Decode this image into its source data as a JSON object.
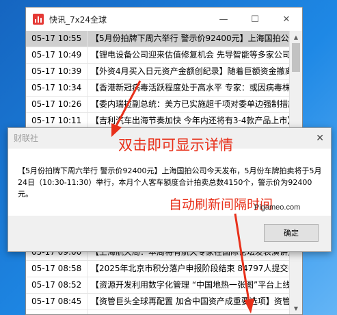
{
  "window": {
    "title": "快讯_7x24全球",
    "icon": "bar-chart-icon",
    "buttons": {
      "minimize": "—",
      "maximize": "☐",
      "close": "✕"
    }
  },
  "news": [
    {
      "time": "05-17 10:55",
      "text": "【5月份拍牌下周六举行 警示价92400元】上海国拍公司今天发布",
      "selected": true
    },
    {
      "time": "05-17 10:49",
      "text": "【锂电设备公司迎来估值修复机会 先导智能等多家公司"
    },
    {
      "time": "05-17 10:39",
      "text": "【外资4月买入日元资产金额创纪录】随着巨额资金撤离"
    },
    {
      "time": "05-17 10:34",
      "text": "【香港新冠病毒活跃程度处于高水平 专家：或因病毒株"
    },
    {
      "time": "05-17 10:26",
      "text": "【委内瑞拉副总统：美方已实施超千项对委单边强制措施"
    },
    {
      "time": "05-17 10:11",
      "text": "【吉利汽车出海节奏加快 今年内还将有3-4款产品上市】"
    },
    {
      "time": "",
      "text": ""
    },
    {
      "time": "",
      "text": ""
    },
    {
      "time": "",
      "text": ""
    },
    {
      "time": "",
      "text": ""
    },
    {
      "time": "",
      "text": ""
    },
    {
      "time": "",
      "text": ""
    },
    {
      "time": "",
      "text": ""
    },
    {
      "time": "05-17 09:00",
      "text": "【上海航天局：本周将有航天专家在国际论坛发表演讲】"
    },
    {
      "time": "05-17 08:58",
      "text": "【2025年北京市积分落户申报阶段结束 84797人提交申请】"
    },
    {
      "time": "05-17 08:52",
      "text": "【资源开发利用数字化管理 “中国地热一张图”平台上线】"
    },
    {
      "time": "05-17 08:45",
      "text": "【资管巨头全球再配置 加合中国资产成重要选项】资管"
    },
    {
      "time": "",
      "text": ""
    }
  ],
  "dialog": {
    "title": "财联社",
    "close": "✕",
    "body": "【5月份拍牌下周六举行 警示价92400元】上海国拍公司今天发布，5月份车牌拍卖将于5月24日（10:30-11:30）举行，本月个人客车额度合计拍卖总数4150个，警示价为92400元。",
    "ok": "确定"
  },
  "annotations": {
    "double_click": "双击即可显示详情",
    "auto_refresh": "自动刷新间隔时间",
    "watermark": "Pigameo.com"
  },
  "colors": {
    "accent": "#e8301a",
    "selected_row": "#cfcfcf"
  }
}
